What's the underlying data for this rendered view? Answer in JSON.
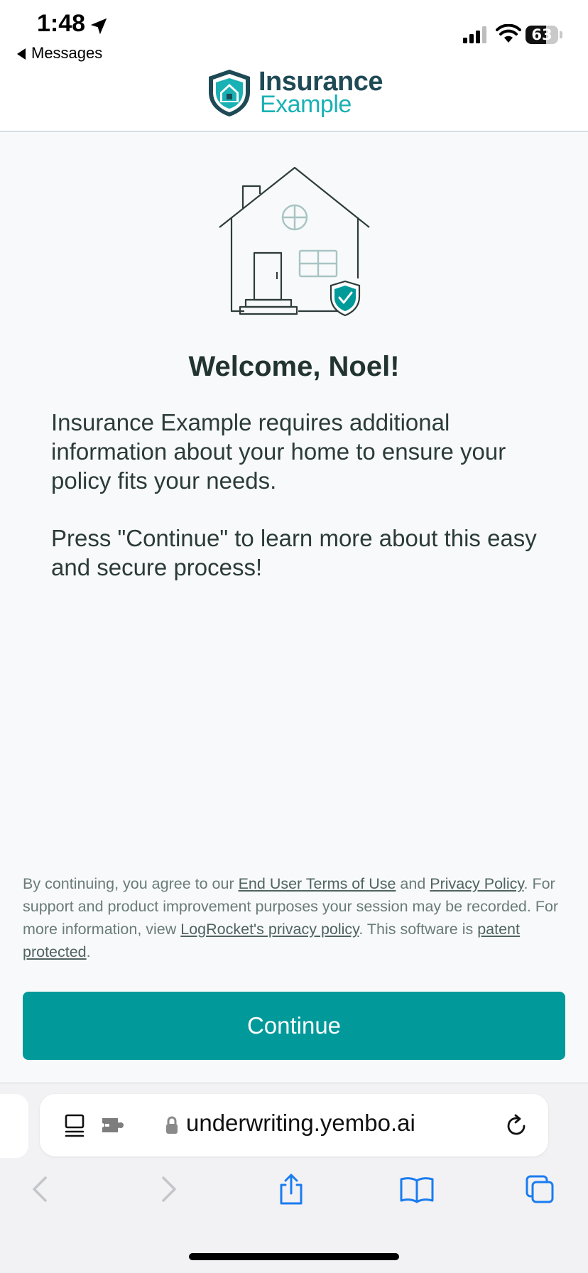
{
  "status_bar": {
    "time": "1:48",
    "back_label": "Messages",
    "battery_level": "63",
    "icons": [
      "location-arrow-icon",
      "cellular-signal-icon",
      "wifi-icon",
      "battery-icon"
    ]
  },
  "brand": {
    "name_line1": "Insurance",
    "name_line2": "Example",
    "colors": {
      "dark": "#1f4a55",
      "accent": "#19b1b4"
    }
  },
  "welcome": {
    "title": "Welcome, Noel!",
    "paragraph1": "Insurance Example requires additional information about your home to ensure your policy fits your needs.",
    "paragraph2": "Press \"Continue\" to learn more about this easy and secure process!"
  },
  "terms": {
    "t1": "By continuing, you agree to our ",
    "link_eula": "End User Terms of Use",
    "t2": " and ",
    "link_privacy": "Privacy Policy",
    "t3": ". For support and product improvement purposes your session may be recorded. For more information, view ",
    "link_logrocket": "LogRocket's privacy policy",
    "t4": ". This software is ",
    "link_patent": "patent protected",
    "t5": "."
  },
  "continue_button": {
    "label": "Continue",
    "color": "#01999a"
  },
  "browser": {
    "url": "underwriting.yembo.ai",
    "toolbar_icons": [
      "back-icon",
      "forward-icon",
      "share-icon",
      "bookmarks-icon",
      "tabs-icon"
    ]
  }
}
